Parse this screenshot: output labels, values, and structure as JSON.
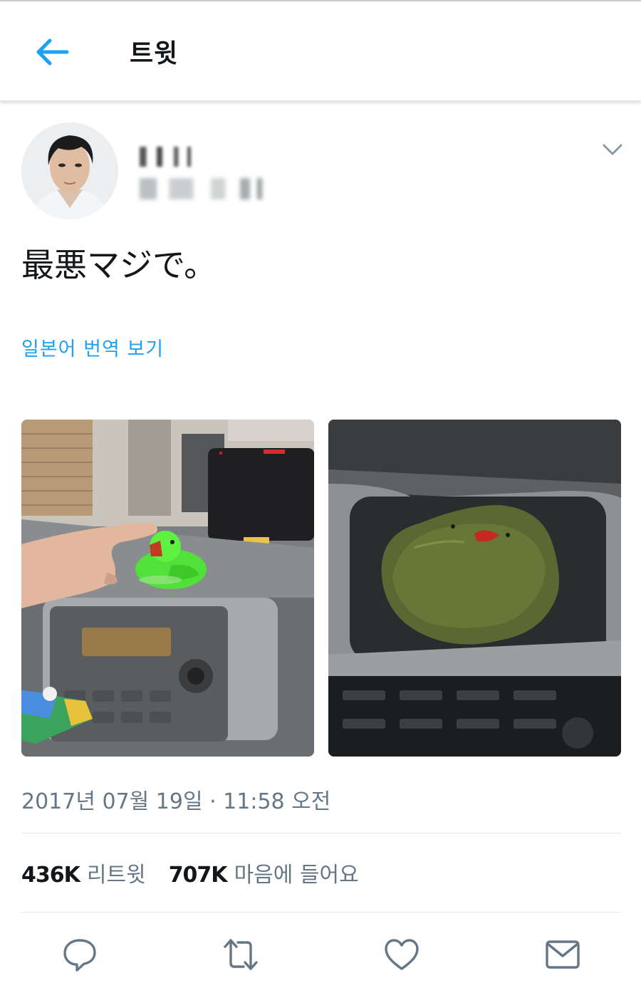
{
  "header": {
    "title": "트윗"
  },
  "tweet": {
    "text": "最悪マジで。",
    "translate_link": "일본어 번역 보기",
    "timestamp": "2017년 07월 19일 · 11:58 오전"
  },
  "stats": {
    "retweets_count": "436K",
    "retweets_label": "리트윗",
    "likes_count": "707K",
    "likes_label": "마음에 들어요"
  },
  "icons": {
    "back": "back-arrow-icon",
    "more": "chevron-down-icon",
    "reply": "reply-icon",
    "retweet": "retweet-icon",
    "like": "heart-icon",
    "message": "mail-icon"
  },
  "colors": {
    "accent": "#1da1f2",
    "text": "#14171a",
    "secondary": "#657786",
    "divider": "#e1e8ed"
  }
}
